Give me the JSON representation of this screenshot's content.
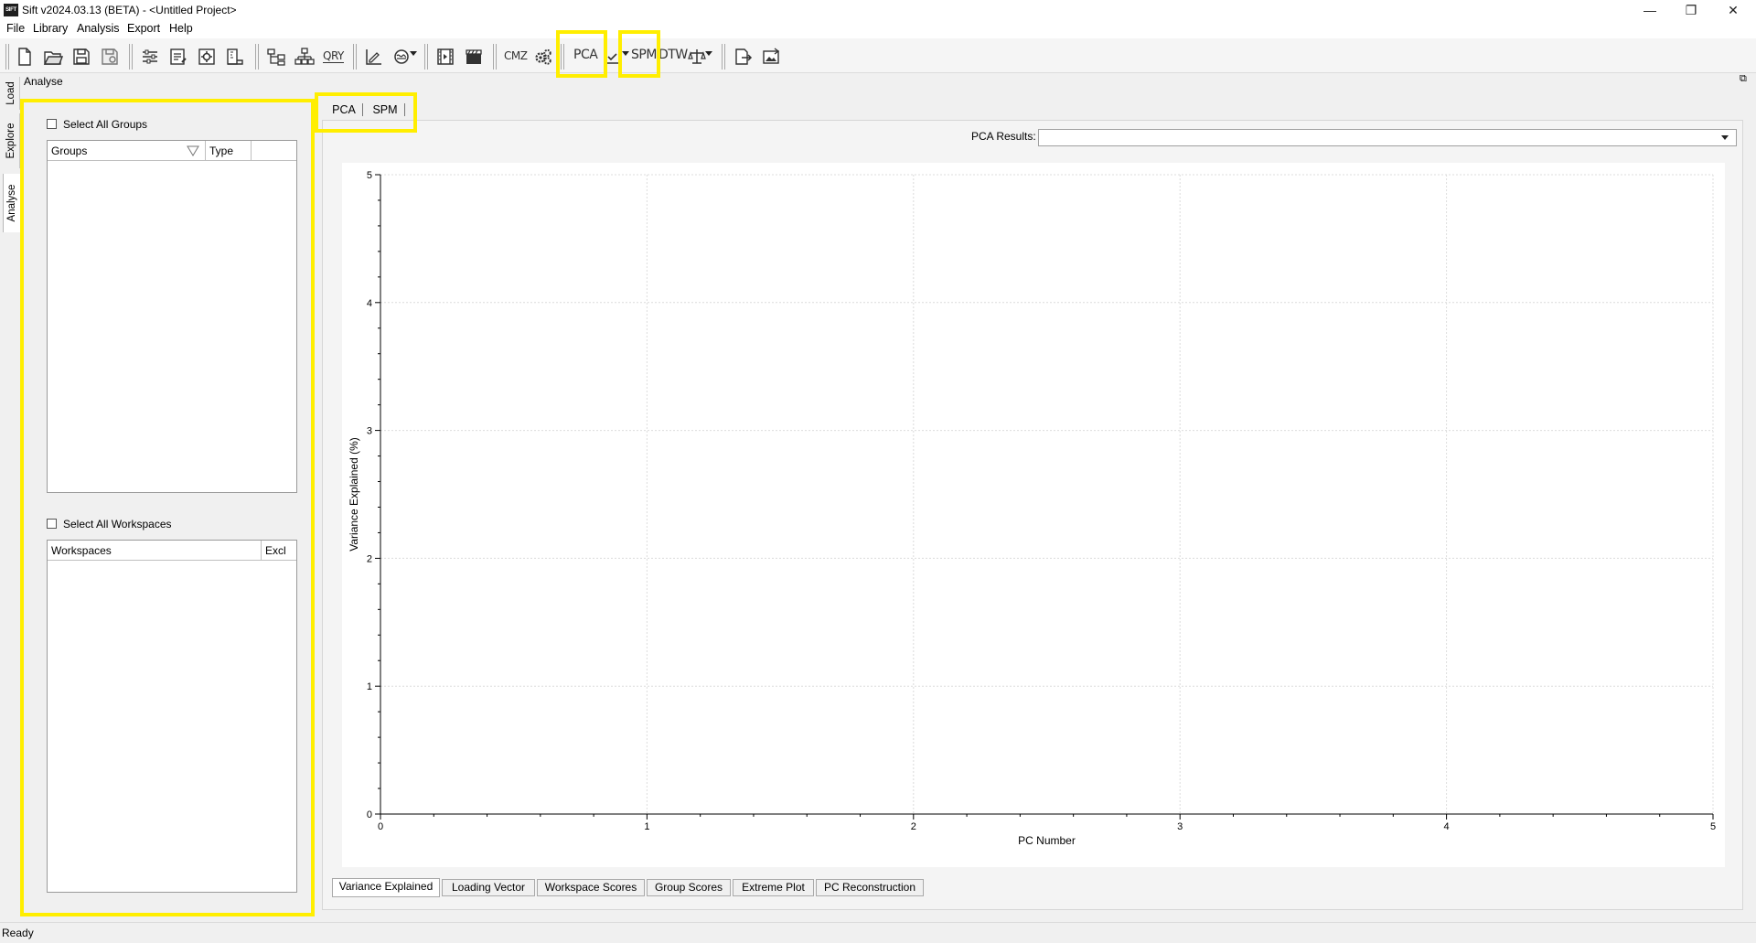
{
  "window": {
    "app_icon_text": "SIFT",
    "title": "Sift v2024.03.13 (BETA) - <Untitled Project>",
    "minimize": "—",
    "maximize": "❐",
    "close": "✕"
  },
  "menu": [
    "File",
    "Library",
    "Analysis",
    "Export",
    "Help"
  ],
  "toolbar": {
    "pca_label": "PCA",
    "spm_label": "SPM",
    "dtw_label": "DTW",
    "cmz_label": "CMZ",
    "qry_label": "QRY"
  },
  "side_tabs": [
    "Load",
    "Explore",
    "Analyse"
  ],
  "panel_title": "Analyse",
  "restore_icon": "⧉",
  "groups": {
    "select_all_label": "Select All Groups",
    "columns": [
      "Groups",
      "Type",
      ""
    ]
  },
  "workspaces": {
    "select_all_label": "Select All Workspaces",
    "columns": [
      "Workspaces",
      "Excl"
    ]
  },
  "main_tabs": [
    "PCA",
    "SPM"
  ],
  "pca_results": {
    "label": "PCA Results:",
    "value": ""
  },
  "chart_data": {
    "type": "line",
    "series": [],
    "xlabel": "PC Number",
    "ylabel": "Variance Explained (%)",
    "xlim": [
      0,
      5
    ],
    "ylim": [
      0,
      5
    ],
    "x_ticks": [
      "0",
      "1",
      "2",
      "3",
      "4",
      "5"
    ],
    "y_ticks": [
      "0",
      "1",
      "2",
      "3",
      "4",
      "5"
    ],
    "grid": true
  },
  "bottom_tabs": [
    "Variance Explained",
    "Loading Vector",
    "Workspace Scores",
    "Group Scores",
    "Extreme Plot",
    "PC Reconstruction"
  ],
  "status": "Ready",
  "colors": {
    "highlight": "#ffee00",
    "grid": "#dcdcdc",
    "axis": "#000000"
  }
}
